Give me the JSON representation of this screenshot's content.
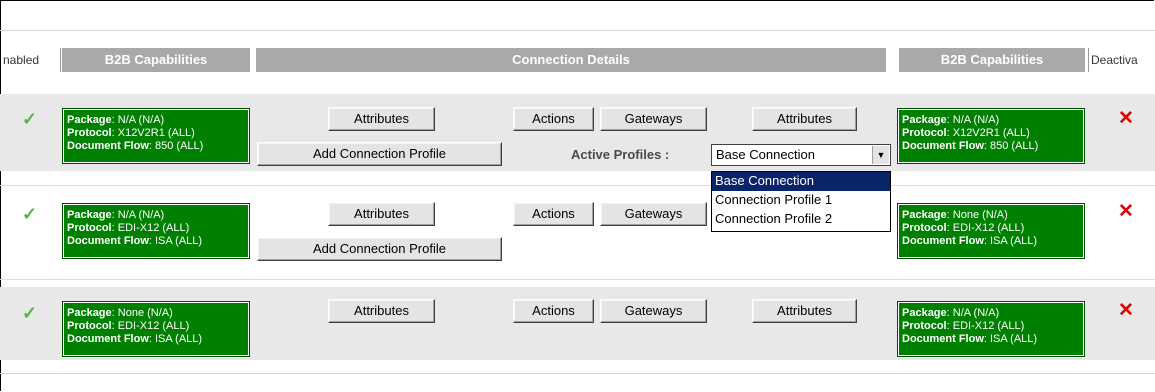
{
  "headers": {
    "enabled": "nabled",
    "b2b_left": "B2B Capabilities",
    "connection_details": "Connection Details",
    "b2b_right": "B2B Capabilities",
    "deactivate": "Deactiva"
  },
  "labels": {
    "package": "Package",
    "protocol": "Protocol",
    "document_flow": "Document Flow",
    "attributes": "Attributes",
    "add_connection_profile": "Add Connection Profile",
    "actions": "Actions",
    "gateways": "Gateways",
    "active_profiles": "Active Profiles :"
  },
  "rows": [
    {
      "left": {
        "package": ": N/A (N/A)",
        "protocol": ": X12V2R1 (ALL)",
        "document_flow": ": 850 (ALL)"
      },
      "right": {
        "package": ": N/A (N/A)",
        "protocol": ": X12V2R1 (ALL)",
        "document_flow": ": 850 (ALL)"
      }
    },
    {
      "left": {
        "package": ": N/A (N/A)",
        "protocol": ": EDI-X12 (ALL)",
        "document_flow": ": ISA (ALL)"
      },
      "right": {
        "package": ": None (N/A)",
        "protocol": ": EDI-X12 (ALL)",
        "document_flow": ": ISA (ALL)"
      }
    },
    {
      "left": {
        "package": ": None (N/A)",
        "protocol": ": EDI-X12 (ALL)",
        "document_flow": ": ISA (ALL)"
      },
      "right": {
        "package": ": N/A (N/A)",
        "protocol": ": EDI-X12 (ALL)",
        "document_flow": ": ISA (ALL)"
      }
    }
  ],
  "active_profiles": {
    "selected": "Base Connection",
    "options": [
      "Base Connection",
      "Connection Profile 1",
      "Connection Profile 2"
    ]
  },
  "icons": {
    "enabled": "check-icon",
    "deactivate": "cross-icon"
  },
  "colors": {
    "capability_bg": "#008000",
    "check": "#58b548",
    "cross": "#e00000",
    "header_bg": "#a9a9a9"
  }
}
